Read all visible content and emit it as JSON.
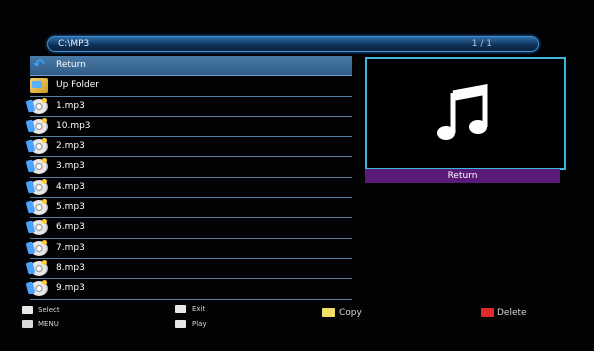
{
  "header": {
    "path": "C:\\MP3",
    "page": "1 / 1"
  },
  "files": [
    {
      "label": "Return",
      "icon": "return-icon",
      "selected": true
    },
    {
      "label": "Up Folder",
      "icon": "folder-icon"
    },
    {
      "label": "1.mp3",
      "icon": "music-file-icon"
    },
    {
      "label": "10.mp3",
      "icon": "music-file-icon"
    },
    {
      "label": "2.mp3",
      "icon": "music-file-icon"
    },
    {
      "label": "3.mp3",
      "icon": "music-file-icon"
    },
    {
      "label": "4.mp3",
      "icon": "music-file-icon"
    },
    {
      "label": "5.mp3",
      "icon": "music-file-icon"
    },
    {
      "label": "6.mp3",
      "icon": "music-file-icon"
    },
    {
      "label": "7.mp3",
      "icon": "music-file-icon"
    },
    {
      "label": "8.mp3",
      "icon": "music-file-icon"
    },
    {
      "label": "9.mp3",
      "icon": "music-file-icon"
    }
  ],
  "preview": {
    "icon": "music-note-icon",
    "label": "Return"
  },
  "footer": {
    "select": "Select",
    "menu": "MENU",
    "exit": "Exit",
    "play": "Play",
    "copy": "Copy",
    "delete": "Delete"
  },
  "colors": {
    "accent": "#3fb6dc",
    "selection": "#3a6a96",
    "preview_label_bg": "#5a1a78",
    "copy_key": "#f2e066",
    "delete_key": "#e02a2a"
  }
}
